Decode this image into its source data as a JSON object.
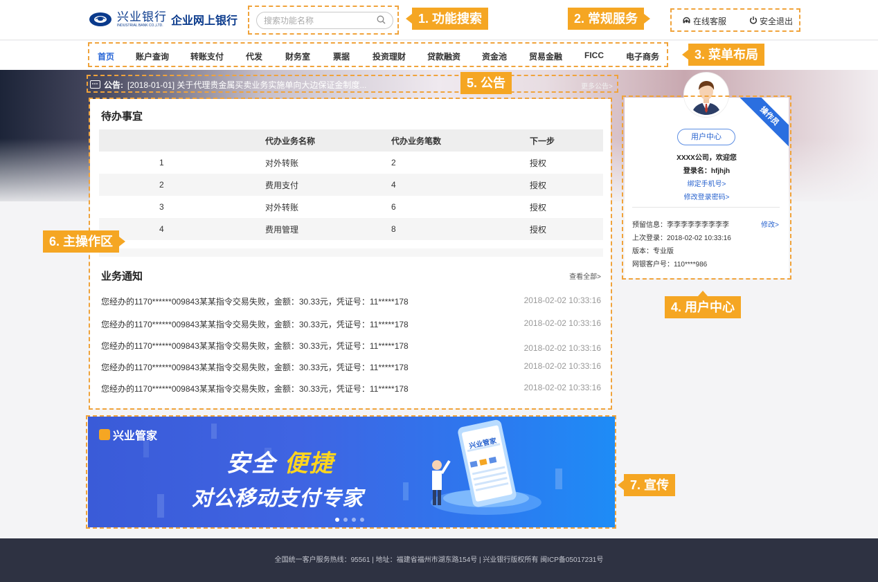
{
  "header": {
    "logo_cn": "兴业银行",
    "logo_en": "INDUSTRIAL BANK CO.,LTD.",
    "logo_sub": "企业网上银行",
    "search_placeholder": "搜索功能名称",
    "online_service": "在线客服",
    "logout": "安全退出"
  },
  "nav": {
    "active_index": 0,
    "items": [
      "首页",
      "账户查询",
      "转账支付",
      "代发",
      "财务室",
      "票据",
      "投资理财",
      "贷款融资",
      "资金池",
      "贸易金融",
      "FICC",
      "电子商务"
    ]
  },
  "notice": {
    "label": "公告:",
    "text": "[2018-01-01] 关于代理贵金属买卖业务实施单向大边保证金制度...",
    "more": "更多公告>"
  },
  "todo": {
    "title": "待办事宜",
    "columns": [
      "",
      "代办业务名称",
      "代办业务笔数",
      "下一步"
    ],
    "rows": [
      [
        "1",
        "对外转账",
        "2",
        "授权"
      ],
      [
        "2",
        "费用支付",
        "4",
        "授权"
      ],
      [
        "3",
        "对外转账",
        "6",
        "授权"
      ],
      [
        "4",
        "费用管理",
        "8",
        "授权"
      ]
    ]
  },
  "biz_notice": {
    "title": "业务通知",
    "view_all": "查看全部>",
    "items": [
      {
        "text": "您经办的1170******009843某某指令交易失败，金额：30.33元，凭证号：11*****178",
        "time": "2018-02-02   10:33:16"
      },
      {
        "text": "您经办的1170******009843某某指令交易失败，金额：30.33元，凭证号：11*****178",
        "time": "2018-02-02   10:33:16"
      },
      {
        "text": "您经办的1170******009843某某指令交易失败，金额：30.33元，凭证号：11*****178",
        "time": "2018-02-02   10:33:16"
      },
      {
        "text": "您经办的1170******009843某某指令交易失败，金额：30.33元，凭证号：11*****178",
        "time": "2018-02-02   10:33:16"
      },
      {
        "text": "您经办的1170******009843某某指令交易失败，金额：30.33元，凭证号：11*****178",
        "time": "2018-02-02   10:33:16"
      }
    ]
  },
  "user": {
    "role_ribbon": "操作员",
    "center_button": "用户中心",
    "welcome": "XXXX公司，欢迎您",
    "login_name": "登录名：hfjhjh",
    "bind_phone": "绑定手机号>",
    "change_password": "修改登录密码>",
    "reserved_info": "预留信息：李李李李李李李李李",
    "modify": "修改>",
    "last_login": "上次登录：2018-02-02 10:33:16",
    "version": "版本：专业版",
    "customer_no": "网银客户号：110****986"
  },
  "banner": {
    "brand": "兴业管家",
    "headline_white": "安全",
    "headline_yellow": "便捷",
    "subline": "对公移动支付专家",
    "phone_brand": "兴业管家",
    "slides": 4,
    "active_slide": 0
  },
  "footer": {
    "text": "全国统一客户服务热线：95561  |  地址：福建省福州市湖东路154号  |  兴业银行版权所有  闽ICP备05017231号"
  },
  "annotations": {
    "a1": "1. 功能搜索",
    "a2": "2. 常规服务",
    "a3": "3. 菜单布局",
    "a4": "4. 用户中心",
    "a5": "5. 公告",
    "a6": "6. 主操作区",
    "a7": "7. 宣传"
  },
  "colors": {
    "accent_blue": "#2765d6",
    "annotation_orange": "#f5a623",
    "footer_bg": "#2e3242"
  }
}
